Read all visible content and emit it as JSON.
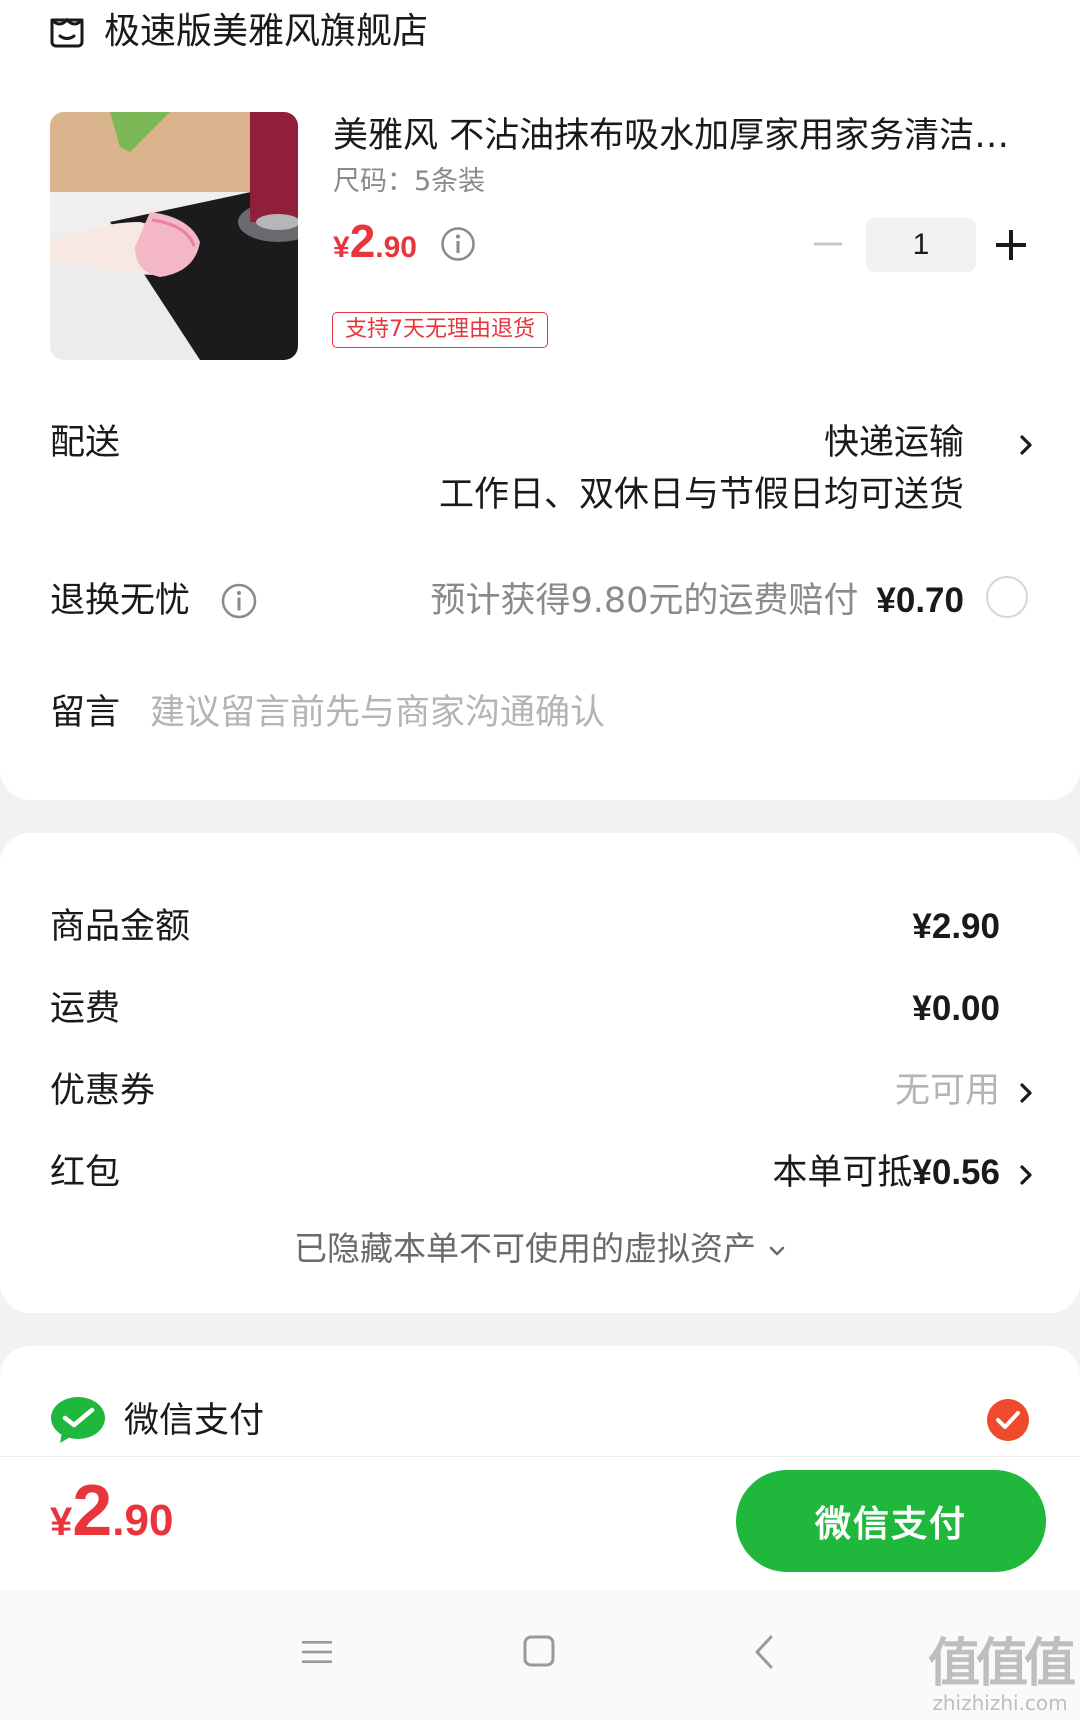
{
  "store": {
    "name": "极速版美雅风旗舰店",
    "icon": "store-icon"
  },
  "product": {
    "title": "美雅风 不沾油抹布吸水加厚家用家务清洁洗碗布",
    "spec": "尺码：5条装",
    "price_currency": "¥",
    "price_int": "2",
    "price_dec": ".90",
    "quantity": "1",
    "return_badge": "支持7天无理由退货"
  },
  "delivery": {
    "label": "配送",
    "method": "快递运输",
    "note": "工作日、双休日与节假日均可送货"
  },
  "worry_free": {
    "label": "退换无忧",
    "desc": "预计获得9.80元的运费赔付",
    "price": "¥0.70"
  },
  "message": {
    "label": "留言",
    "placeholder": "建议留言前先与商家沟通确认"
  },
  "summary": {
    "goods_label": "商品金额",
    "goods_value": "¥2.90",
    "freight_label": "运费",
    "freight_value": "¥0.00",
    "coupon_label": "优惠券",
    "coupon_value": "无可用",
    "redpacket_label": "红包",
    "redpacket_prefix": "本单可抵",
    "redpacket_amount": "¥0.56",
    "hidden_assets": "已隐藏本单不可使用的虚拟资产"
  },
  "payment": {
    "method_label": "微信支付",
    "selected": true
  },
  "bottom": {
    "total_currency": "¥",
    "total_int": "2",
    "total_dec": ".90",
    "pay_button": "微信支付"
  },
  "watermark": {
    "main": "值值值",
    "sub": "zhizhizhi.com"
  },
  "colors": {
    "price_red": "#e8353b",
    "wechat_green": "#1fb83d"
  }
}
